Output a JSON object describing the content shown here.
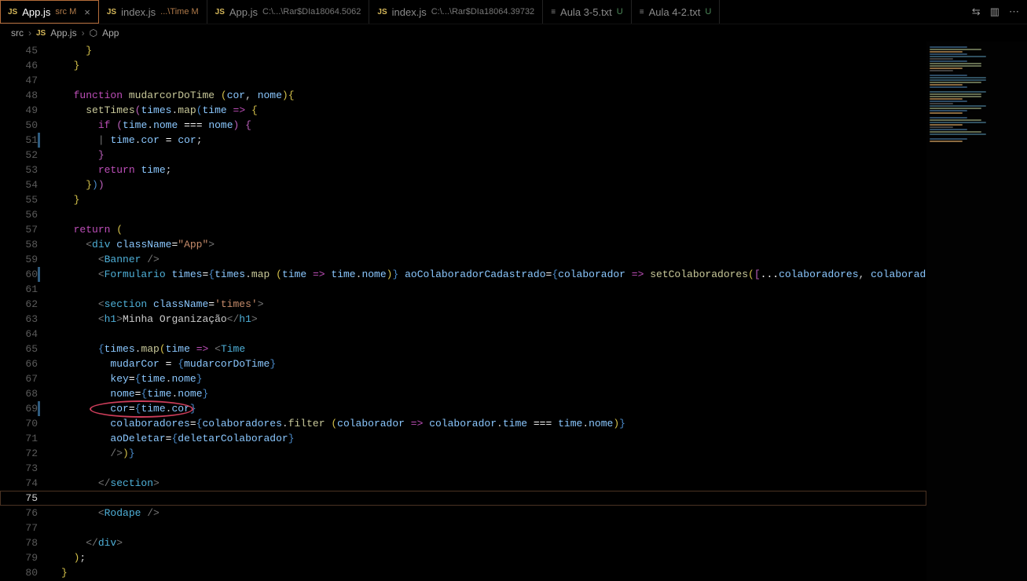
{
  "tabs": [
    {
      "icon": "JS",
      "iconClass": "js",
      "label": "App.js",
      "descr": "src M",
      "descrClass": "mod",
      "close": "×",
      "active": true
    },
    {
      "icon": "JS",
      "iconClass": "js",
      "label": "index.js",
      "descr": "...\\Time M",
      "descrClass": "mod",
      "close": "",
      "active": false
    },
    {
      "icon": "JS",
      "iconClass": "js",
      "label": "App.js",
      "descr": "C:\\...\\Rar$DIa18064.5062",
      "descrClass": "",
      "close": "",
      "active": false
    },
    {
      "icon": "JS",
      "iconClass": "js",
      "label": "index.js",
      "descr": "C:\\...\\Rar$DIa18064.39732",
      "descrClass": "",
      "close": "",
      "active": false
    },
    {
      "icon": "≡",
      "iconClass": "txt",
      "label": "Aula 3-5.txt",
      "descr": "U",
      "descrClass": "unt",
      "close": "",
      "active": false
    },
    {
      "icon": "≡",
      "iconClass": "txt",
      "label": "Aula 4-2.txt",
      "descr": "U",
      "descrClass": "unt",
      "close": "",
      "active": false
    }
  ],
  "actions": {
    "compare": "⇆",
    "split": "▥",
    "more": "⋯"
  },
  "breadcrumbs": {
    "part1": "src",
    "part2": "App.js",
    "part3": "App",
    "sep": "›",
    "jsIcon": "JS",
    "cube": "⬡"
  },
  "code": {
    "startLine": 45,
    "cursorLine": 75,
    "circledLine": 69,
    "modifiedLines": [
      51,
      60,
      69
    ],
    "lines": [
      {
        "n": 45,
        "html": "    <span class='p1'>}</span>"
      },
      {
        "n": 46,
        "html": "  <span class='p1'>}</span>"
      },
      {
        "n": 47,
        "html": ""
      },
      {
        "n": 48,
        "html": "  <span class='kw'>function</span> <span class='fn'>mudarcorDoTime</span> <span class='p1'>(</span><span class='var'>cor</span>, <span class='var'>nome</span><span class='p1'>)</span><span class='p1'>{</span>"
      },
      {
        "n": 49,
        "html": "    <span class='fn'>setTimes</span><span class='p2'>(</span><span class='var'>times</span>.<span class='fn'>map</span><span class='p3'>(</span><span class='var'>time</span> <span class='kw'>=&gt;</span> <span class='p1'>{</span>"
      },
      {
        "n": 50,
        "html": "      <span class='kw'>if</span> <span class='p2'>(</span><span class='var'>time</span>.<span class='var'>nome</span> <span class='op'>===</span> <span class='var'>nome</span><span class='p2'>)</span> <span class='p2'>{</span>"
      },
      {
        "n": 51,
        "html": "      <span class='tag'>|</span> <span class='var'>time</span>.<span class='var'>cor</span> <span class='op'>=</span> <span class='var'>cor</span>;"
      },
      {
        "n": 52,
        "html": "      <span class='p2'>}</span>"
      },
      {
        "n": 53,
        "html": "      <span class='kw'>return</span> <span class='var'>time</span>;"
      },
      {
        "n": 54,
        "html": "    <span class='p1'>}</span><span class='p3'>)</span><span class='p2'>)</span>"
      },
      {
        "n": 55,
        "html": "  <span class='p1'>}</span>"
      },
      {
        "n": 56,
        "html": ""
      },
      {
        "n": 57,
        "html": "  <span class='kw'>return</span> <span class='p1'>(</span>"
      },
      {
        "n": 58,
        "html": "    <span class='tag'>&lt;</span><span class='ent'>div</span> <span class='attr'>className</span><span class='op'>=</span><span class='str'>\"App\"</span><span class='tag'>&gt;</span>"
      },
      {
        "n": 59,
        "html": "      <span class='tag'>&lt;</span><span class='ent'>Banner</span> <span class='tag'>/&gt;</span>"
      },
      {
        "n": 60,
        "html": "      <span class='tag'>&lt;</span><span class='ent'>Formulario</span> <span class='attr'>times</span><span class='op'>=</span><span class='p3'>{</span><span class='var'>times</span>.<span class='fn'>map</span> <span class='p1'>(</span><span class='var'>time</span> <span class='kw'>=&gt;</span> <span class='var'>time</span>.<span class='var'>nome</span><span class='p1'>)</span><span class='p3'>}</span> <span class='attr'>aoColaboradorCadastrado</span><span class='op'>=</span><span class='p3'>{</span><span class='var'>colaborador</span> <span class='kw'>=&gt;</span> <span class='fn'>setColaboradores</span><span class='p1'>(</span><span class='p2'>[</span><span class='op'>...</span><span class='var'>colaboradores</span>, <span class='var'>colaborador</span><span class='p2'>]</span>"
      },
      {
        "n": 61,
        "html": ""
      },
      {
        "n": 62,
        "html": "      <span class='tag'>&lt;</span><span class='ent'>section</span> <span class='attr'>className</span><span class='op'>=</span><span class='str'>'times'</span><span class='tag'>&gt;</span>"
      },
      {
        "n": 63,
        "html": "      <span class='tag'>&lt;</span><span class='ent'>h1</span><span class='tag'>&gt;</span>Minha Organização<span class='tag'>&lt;/</span><span class='ent'>h1</span><span class='tag'>&gt;</span>"
      },
      {
        "n": 64,
        "html": ""
      },
      {
        "n": 65,
        "html": "      <span class='p3'>{</span><span class='var'>times</span>.<span class='fn'>map</span><span class='p1'>(</span><span class='var'>time</span> <span class='kw'>=&gt;</span> <span class='tag'>&lt;</span><span class='ent'>Time</span>"
      },
      {
        "n": 66,
        "html": "        <span class='attr'>mudarCor</span> <span class='op'>=</span> <span class='p3'>{</span><span class='var'>mudarcorDoTime</span><span class='p3'>}</span>"
      },
      {
        "n": 67,
        "html": "        <span class='attr'>key</span><span class='op'>=</span><span class='p3'>{</span><span class='var'>time</span>.<span class='var'>nome</span><span class='p3'>}</span>"
      },
      {
        "n": 68,
        "html": "        <span class='attr'>nome</span><span class='op'>=</span><span class='p3'>{</span><span class='var'>time</span>.<span class='var'>nome</span><span class='p3'>}</span>"
      },
      {
        "n": 69,
        "html": "        <span class='attr'>cor</span><span class='op'>=</span><span class='p3'>{</span><span class='var'>time</span>.<span class='var'>cor</span><span class='p3'>}</span>"
      },
      {
        "n": 70,
        "html": "        <span class='attr'>colaboradores</span><span class='op'>=</span><span class='p3'>{</span><span class='var'>colaboradores</span>.<span class='fn'>filter</span> <span class='p1'>(</span><span class='var'>colaborador</span> <span class='kw'>=&gt;</span> <span class='var'>colaborador</span>.<span class='var'>time</span> <span class='op'>===</span> <span class='var'>time</span>.<span class='var'>nome</span><span class='p1'>)</span><span class='p3'>}</span>"
      },
      {
        "n": 71,
        "html": "        <span class='attr'>aoDeletar</span><span class='op'>=</span><span class='p3'>{</span><span class='var'>deletarColaborador</span><span class='p3'>}</span>"
      },
      {
        "n": 72,
        "html": "        <span class='tag'>/&gt;</span><span class='p1'>)</span><span class='p3'>}</span>"
      },
      {
        "n": 73,
        "html": ""
      },
      {
        "n": 74,
        "html": "      <span class='tag'>&lt;/</span><span class='ent'>section</span><span class='tag'>&gt;</span>"
      },
      {
        "n": 75,
        "html": ""
      },
      {
        "n": 76,
        "html": "      <span class='tag'>&lt;</span><span class='ent'>Rodape</span> <span class='tag'>/&gt;</span>"
      },
      {
        "n": 77,
        "html": ""
      },
      {
        "n": 78,
        "html": "    <span class='tag'>&lt;/</span><span class='ent'>div</span><span class='tag'>&gt;</span>"
      },
      {
        "n": 79,
        "html": "  <span class='p1'>)</span>;"
      },
      {
        "n": 80,
        "html": "<span class='p1'>}</span>"
      }
    ]
  }
}
